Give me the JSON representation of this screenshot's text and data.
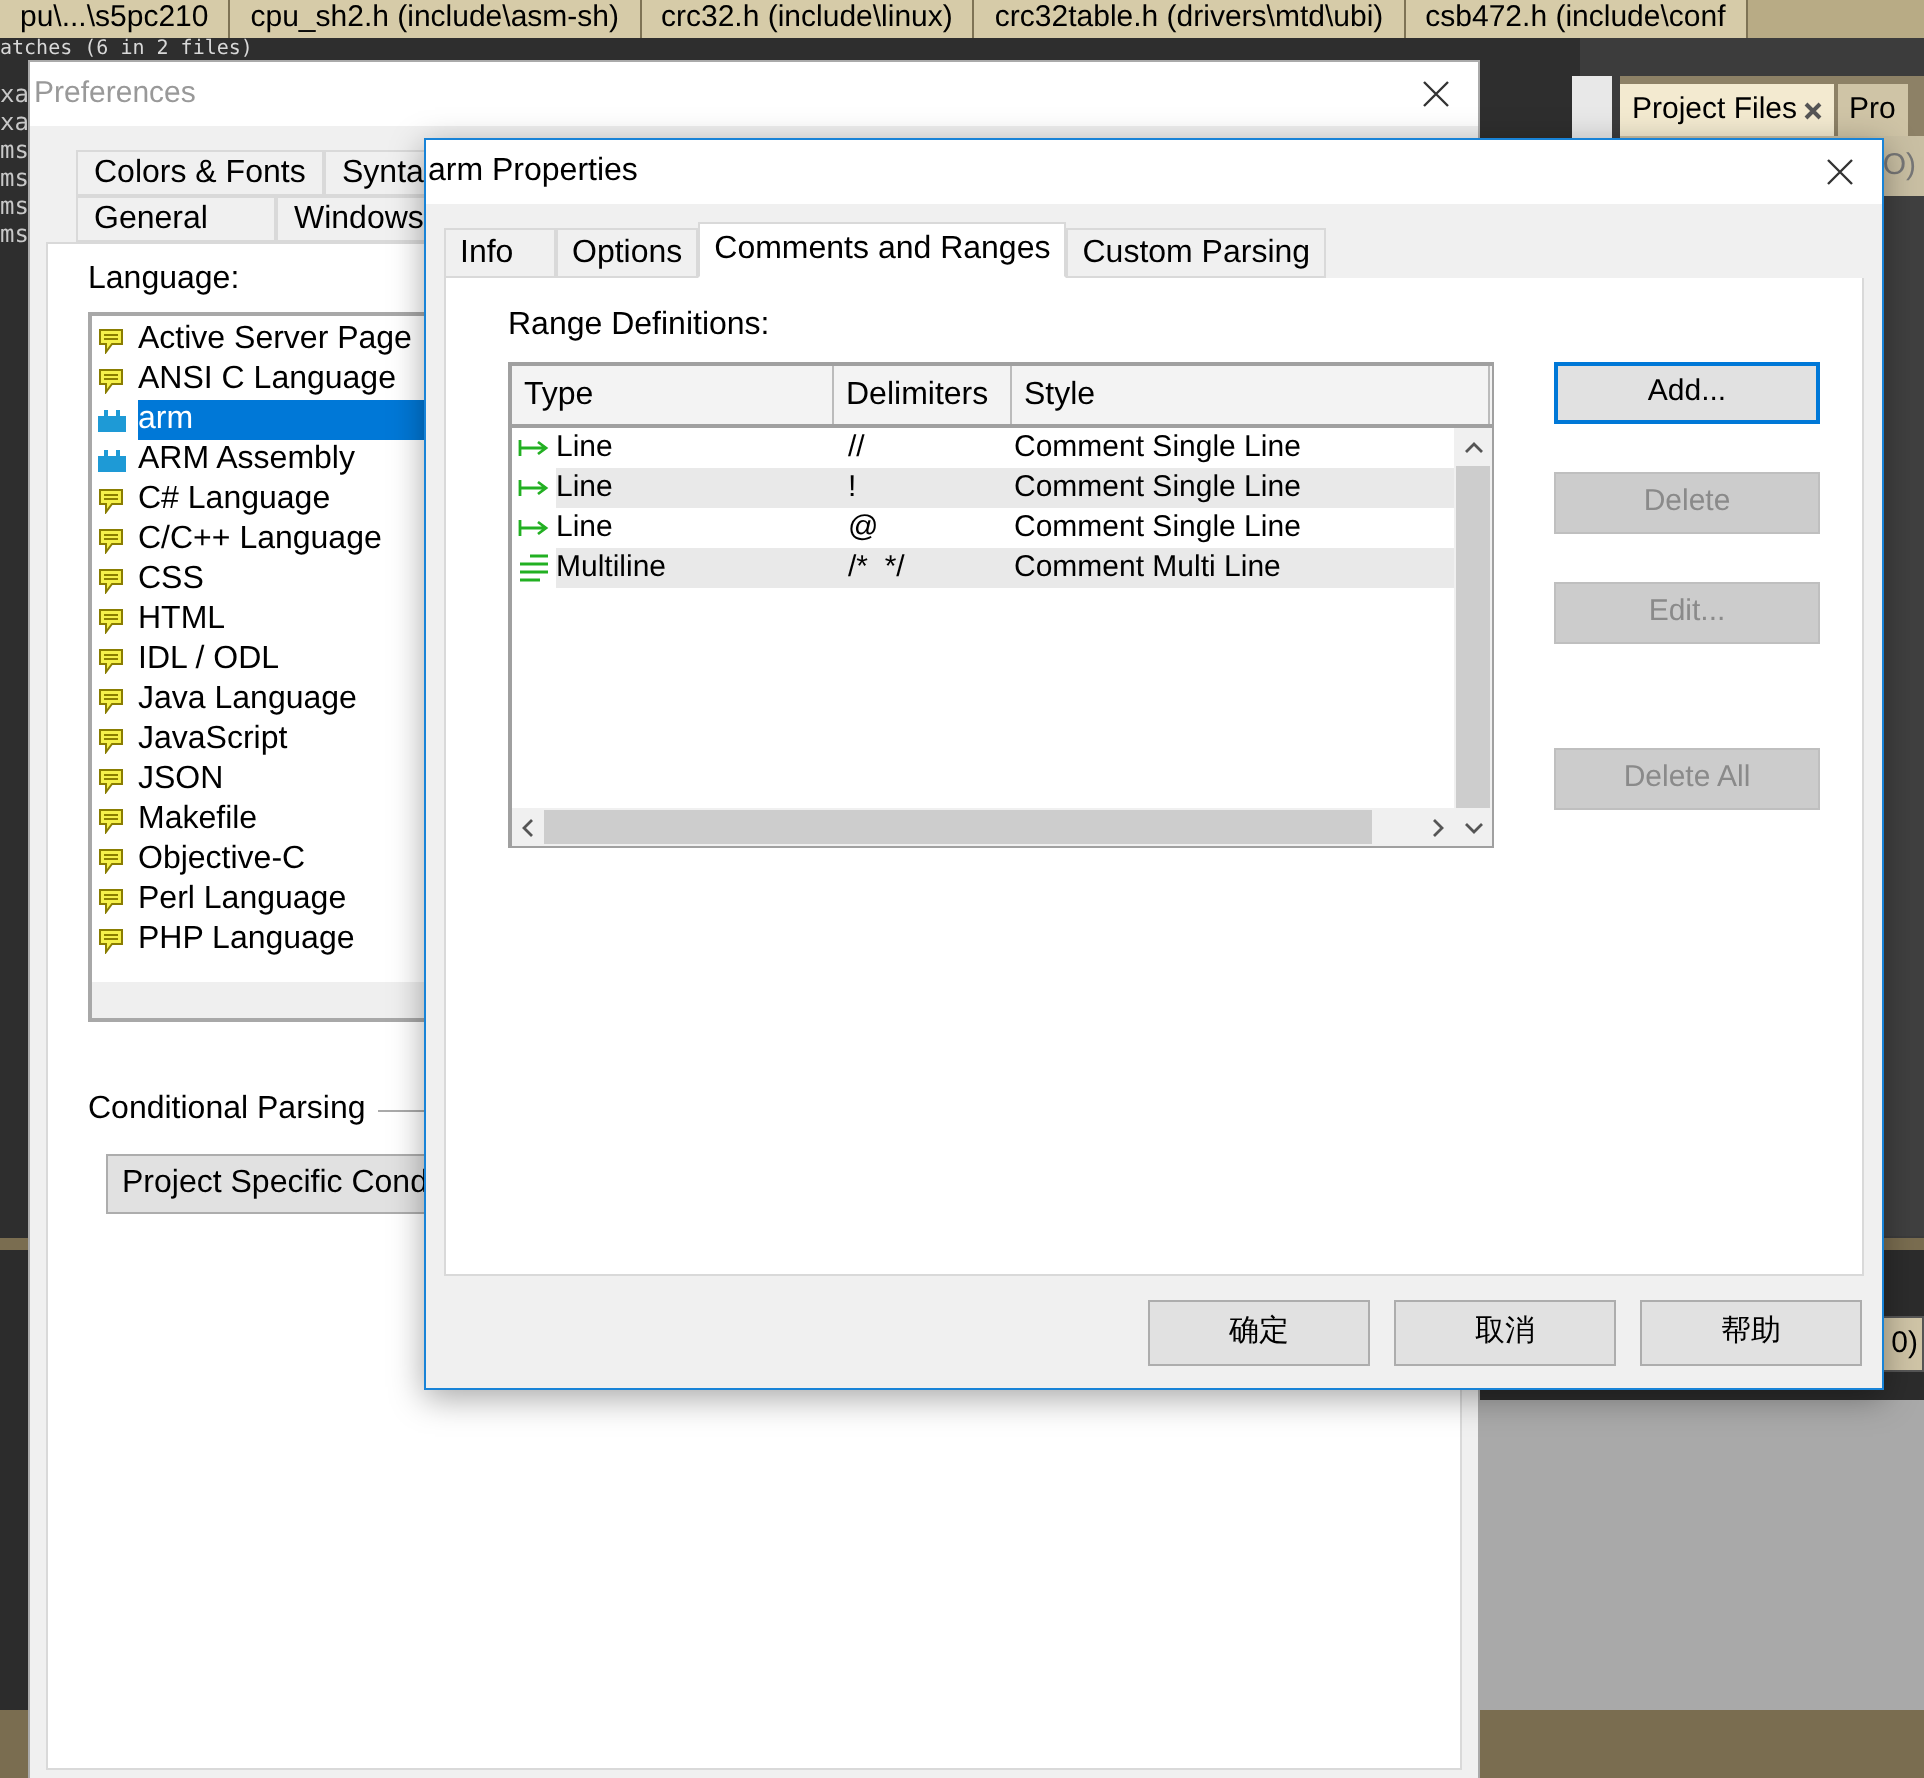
{
  "editor_tabs": [
    "pu\\...\\s5pc210",
    "cpu_sh2.h (include\\asm-sh)",
    "crc32.h (include\\linux)",
    "crc32table.h (drivers\\mtd\\ubi)",
    "csb472.h (include\\conf"
  ],
  "search_results_header": "atches (6 in 2 files)",
  "editor_lines": [
    "xa",
    "xa",
    "ms",
    "ms",
    "ms",
    "ms"
  ],
  "side_panel": {
    "tabs": [
      {
        "label": "Project Files",
        "selected": true
      },
      {
        "label": "Pro",
        "selected": false
      }
    ],
    "fragments": [
      "O)",
      "0)"
    ]
  },
  "preferences": {
    "title": "Preferences",
    "tab_rows": [
      [
        {
          "label": "Colors & Fonts",
          "selected": false
        },
        {
          "label": "Synta",
          "selected": false
        }
      ],
      [
        {
          "label": "General",
          "selected": false
        },
        {
          "label": "Windows",
          "selected": false
        }
      ]
    ],
    "language_label": "Language:",
    "languages": [
      {
        "name": "Active Server Page",
        "kind": "bubble",
        "selected": false
      },
      {
        "name": "ANSI C Language",
        "kind": "bubble",
        "selected": false
      },
      {
        "name": "arm",
        "kind": "block",
        "selected": true
      },
      {
        "name": "ARM Assembly",
        "kind": "block",
        "selected": false
      },
      {
        "name": "C# Language",
        "kind": "bubble",
        "selected": false
      },
      {
        "name": "C/C++ Language",
        "kind": "bubble",
        "selected": false
      },
      {
        "name": "CSS",
        "kind": "bubble",
        "selected": false
      },
      {
        "name": "HTML",
        "kind": "bubble",
        "selected": false
      },
      {
        "name": "IDL / ODL",
        "kind": "bubble",
        "selected": false
      },
      {
        "name": "Java Language",
        "kind": "bubble",
        "selected": false
      },
      {
        "name": "JavaScript",
        "kind": "bubble",
        "selected": false
      },
      {
        "name": "JSON",
        "kind": "bubble",
        "selected": false
      },
      {
        "name": "Makefile",
        "kind": "bubble",
        "selected": false
      },
      {
        "name": "Objective-C",
        "kind": "bubble",
        "selected": false
      },
      {
        "name": "Perl Language",
        "kind": "bubble",
        "selected": false
      },
      {
        "name": "PHP Language",
        "kind": "bubble",
        "selected": false
      }
    ],
    "conditional_parsing_label": "Conditional Parsing",
    "project_button": "Project Specific Cond"
  },
  "properties": {
    "title": "arm Properties",
    "tabs": [
      {
        "label": "Info",
        "selected": false
      },
      {
        "label": "Options",
        "selected": false
      },
      {
        "label": "Comments and Ranges",
        "selected": true
      },
      {
        "label": "Custom Parsing",
        "selected": false
      }
    ],
    "range_label": "Range Definitions:",
    "columns": [
      "Type",
      "Delimiters",
      "Style"
    ],
    "rows": [
      {
        "kind": "line",
        "type": "Line",
        "delimiters": "//",
        "style": "Comment Single Line"
      },
      {
        "kind": "line",
        "type": "Line",
        "delimiters": "!",
        "style": "Comment Single Line"
      },
      {
        "kind": "line",
        "type": "Line",
        "delimiters": "@",
        "style": "Comment Single Line"
      },
      {
        "kind": "multiline",
        "type": "Multiline",
        "delimiters": "/*  */",
        "style": "Comment Multi Line"
      }
    ],
    "side_buttons": [
      {
        "label": "Add...",
        "disabled": false,
        "focused": true
      },
      {
        "label": "Delete",
        "disabled": true,
        "focused": false
      },
      {
        "label": "Edit...",
        "disabled": true,
        "focused": false
      },
      {
        "label": "Delete All",
        "disabled": true,
        "focused": false
      }
    ],
    "dialog_buttons": [
      "确定",
      "取消",
      "帮助"
    ]
  }
}
